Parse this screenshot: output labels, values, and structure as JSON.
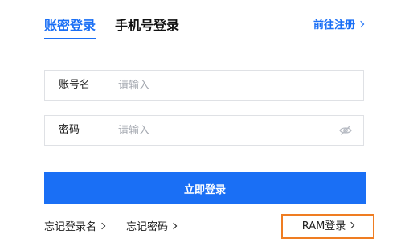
{
  "tabs": {
    "account": "账密登录",
    "phone": "手机号登录"
  },
  "register_link": "前往注册",
  "fields": {
    "account": {
      "label": "账号名",
      "placeholder": "请输入",
      "value": ""
    },
    "password": {
      "label": "密码",
      "placeholder": "请输入",
      "value": ""
    }
  },
  "login_button": "立即登录",
  "links": {
    "forgot_username": "忘记登录名",
    "forgot_password": "忘记密码",
    "ram_login": "RAM登录"
  },
  "colors": {
    "accent": "#1a6ff5",
    "highlight_border": "#ef7d22"
  },
  "icons": {
    "chevron": "chevron-right-icon",
    "password_toggle": "eye-hidden-icon"
  }
}
